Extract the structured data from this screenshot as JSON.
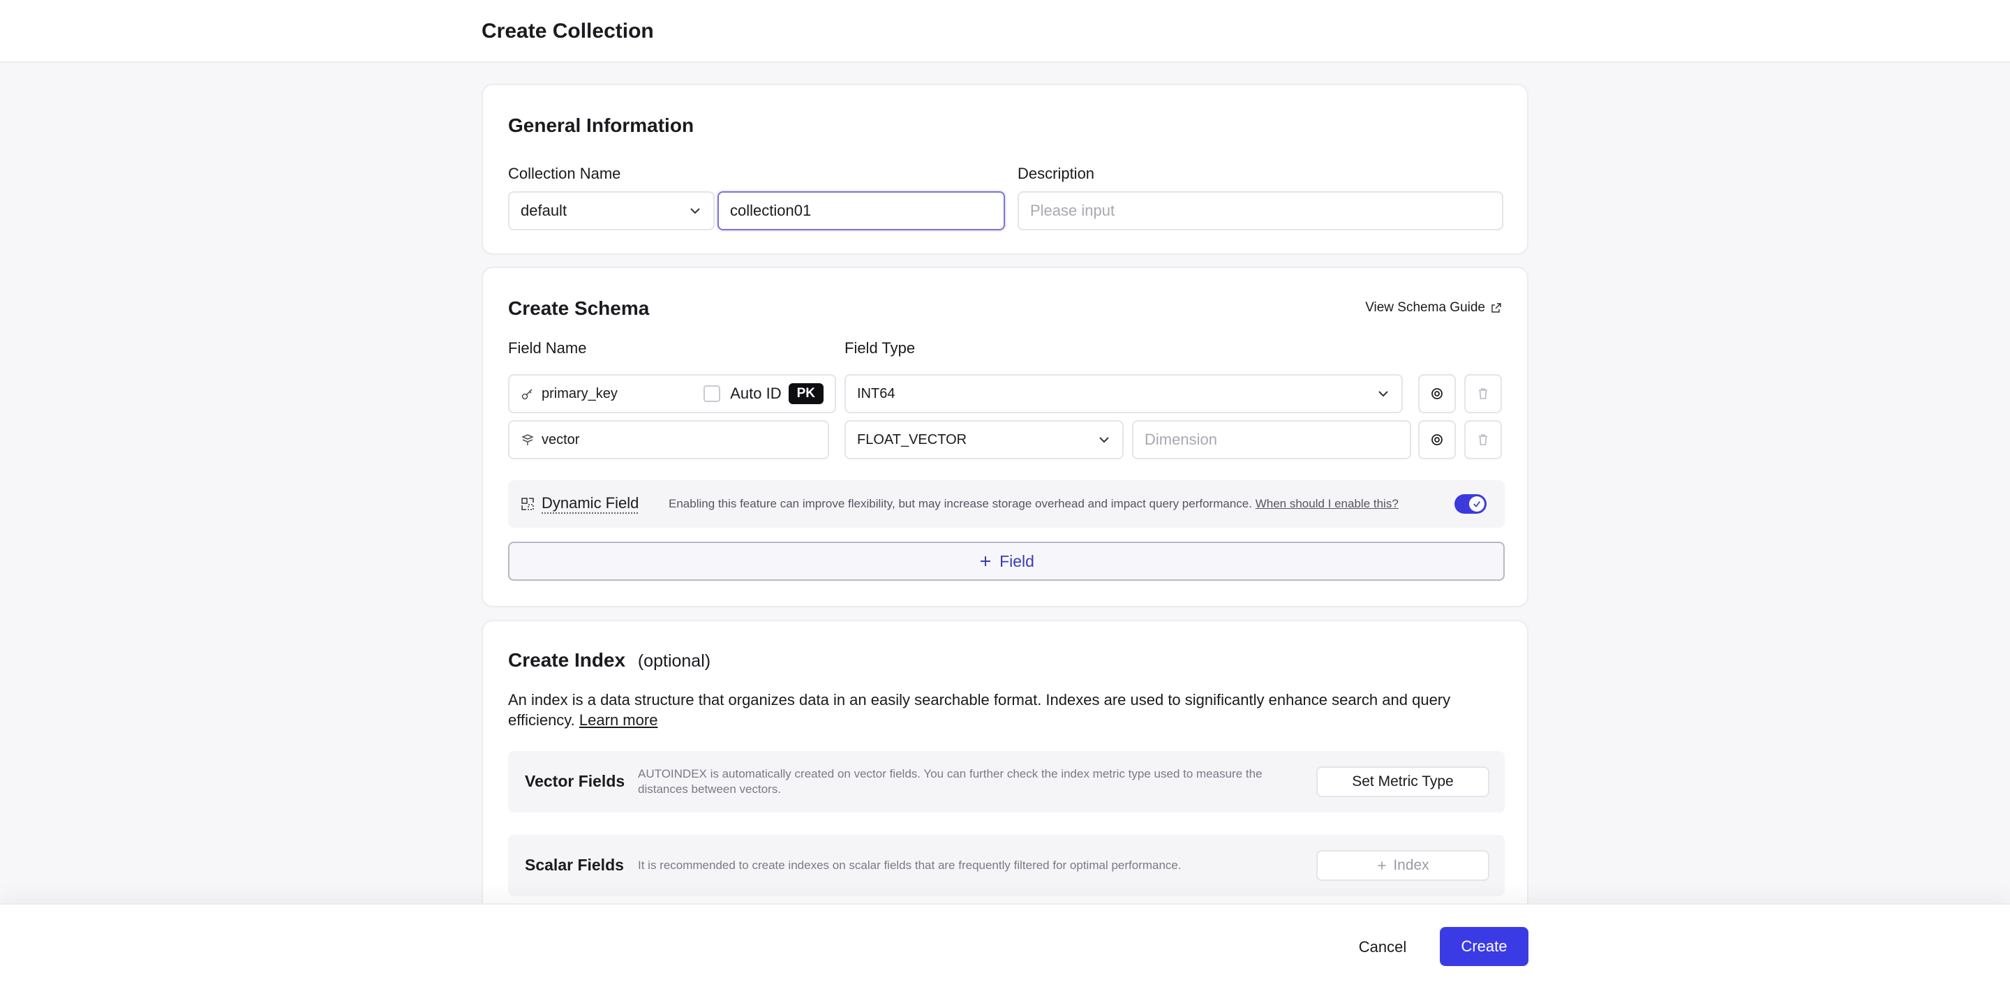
{
  "header": {
    "title": "Create Collection"
  },
  "general": {
    "title": "General Information",
    "collection_name_label": "Collection Name",
    "database_value": "default",
    "collection_name_value": "collection01",
    "description_label": "Description",
    "description_placeholder": "Please input"
  },
  "schema": {
    "title": "Create Schema",
    "guide_link": "View Schema Guide",
    "field_name_label": "Field Name",
    "field_type_label": "Field Type",
    "fields": [
      {
        "name": "primary_key",
        "auto_id_label": "Auto ID",
        "auto_id_checked": false,
        "badge": "PK",
        "type": "INT64",
        "icon": "key-icon"
      },
      {
        "name": "vector",
        "type": "FLOAT_VECTOR",
        "dimension_placeholder": "Dimension",
        "icon": "vector-icon"
      }
    ],
    "dynamic": {
      "label": "Dynamic Field",
      "description": "Enabling this feature can improve flexibility, but may increase storage overhead and impact query performance.",
      "link": "When should I enable this?",
      "enabled": true
    },
    "add_field_label": "Field"
  },
  "index": {
    "title": "Create Index",
    "optional": "(optional)",
    "description": "An index is a data structure that organizes data in an easily searchable format. Indexes are used to significantly enhance search and query efficiency.",
    "learn_more": "Learn more",
    "vector_fields": {
      "name": "Vector Fields",
      "description": "AUTOINDEX is automatically created on vector fields. You can further check the index metric type used to measure the distances between vectors.",
      "button": "Set Metric Type"
    },
    "scalar_fields": {
      "name": "Scalar Fields",
      "description": "It is recommended to create indexes on scalar fields that are frequently filtered for optimal performance.",
      "button": "Index"
    }
  },
  "footer": {
    "cancel": "Cancel",
    "create": "Create"
  },
  "colors": {
    "accent": "#3b3be6",
    "toggle_on": "#3b3bdc",
    "badge": "#0d0d12"
  }
}
